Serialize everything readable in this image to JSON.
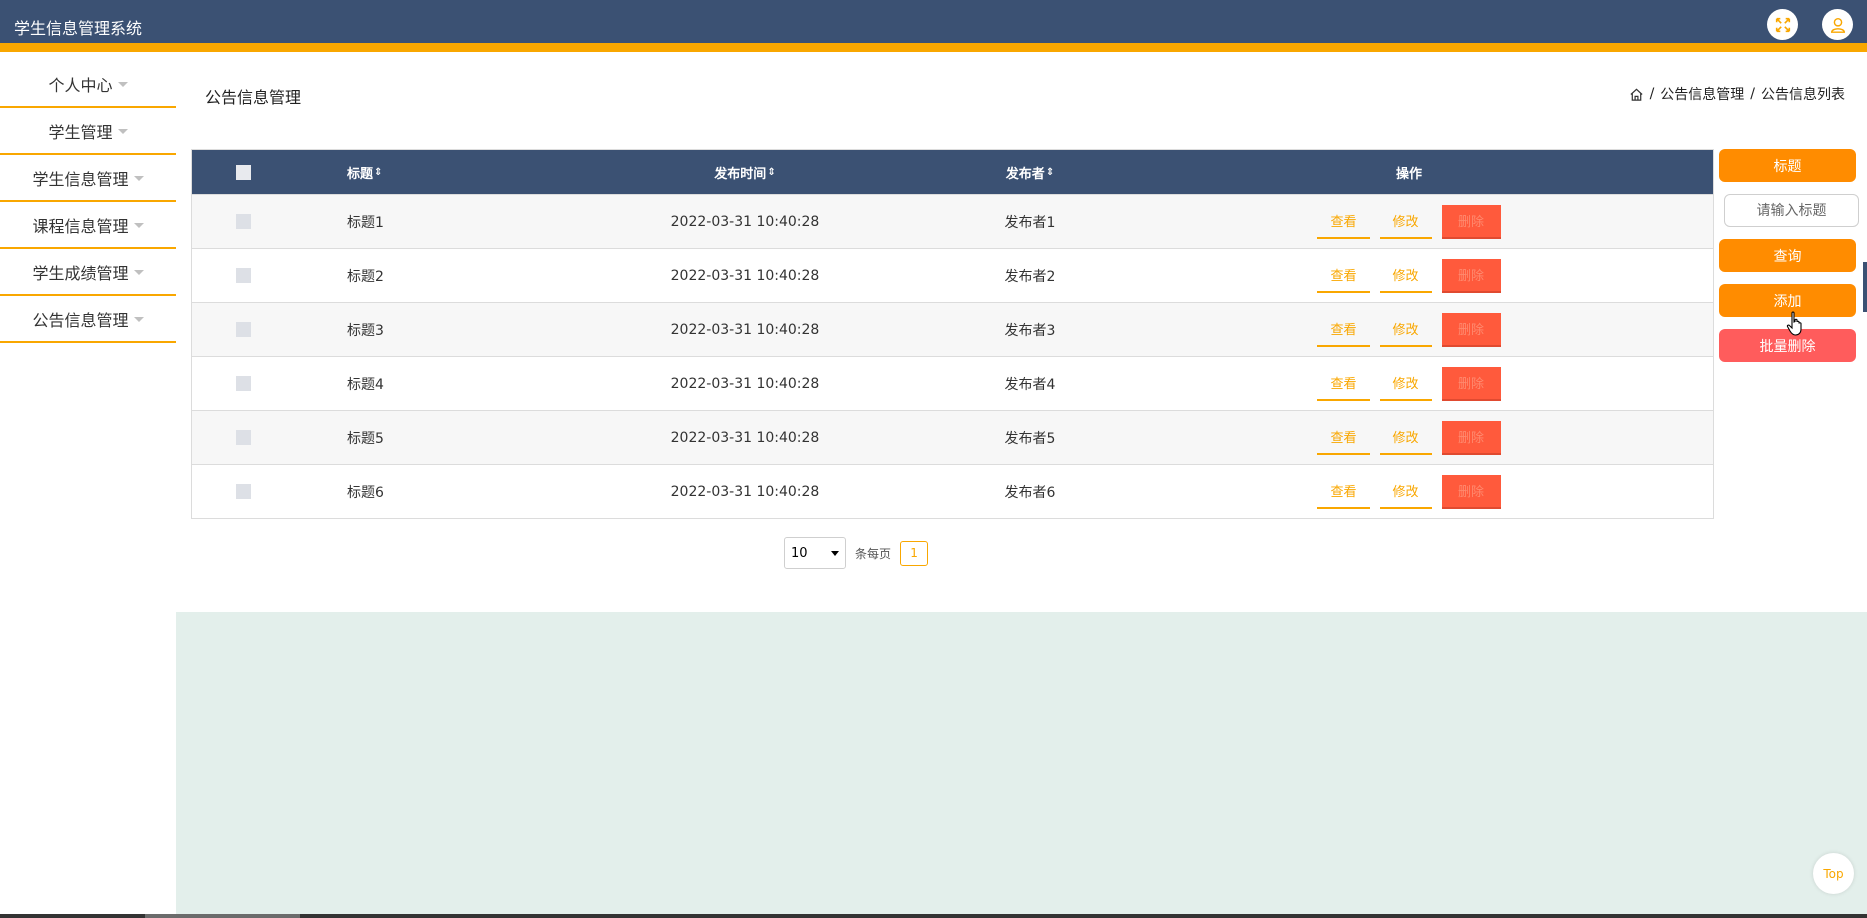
{
  "app": {
    "title": "学生信息管理系统"
  },
  "header": {
    "icons": [
      "fullscreen-icon",
      "user-icon"
    ]
  },
  "sidebar": {
    "items": [
      {
        "label": "个人中心"
      },
      {
        "label": "学生管理"
      },
      {
        "label": "学生信息管理"
      },
      {
        "label": "课程信息管理"
      },
      {
        "label": "学生成绩管理"
      },
      {
        "label": "公告信息管理"
      }
    ]
  },
  "page": {
    "title": "公告信息管理",
    "breadcrumb": {
      "sep": "/",
      "level1": "公告信息管理",
      "level2": "公告信息列表"
    }
  },
  "table": {
    "columns": {
      "title": "标题",
      "time": "发布时间",
      "publisher": "发布者",
      "ops": "操作",
      "sort_icon": "⇕"
    },
    "rows": [
      {
        "title": "标题1",
        "time": "2022-03-31 10:40:28",
        "publisher": "发布者1"
      },
      {
        "title": "标题2",
        "time": "2022-03-31 10:40:28",
        "publisher": "发布者2"
      },
      {
        "title": "标题3",
        "time": "2022-03-31 10:40:28",
        "publisher": "发布者3"
      },
      {
        "title": "标题4",
        "time": "2022-03-31 10:40:28",
        "publisher": "发布者4"
      },
      {
        "title": "标题5",
        "time": "2022-03-31 10:40:28",
        "publisher": "发布者5"
      },
      {
        "title": "标题6",
        "time": "2022-03-31 10:40:28",
        "publisher": "发布者6"
      }
    ],
    "actions": {
      "view": "查看",
      "edit": "修改",
      "delete": "删除"
    }
  },
  "pagination": {
    "page_size": "10",
    "per_page_label": "条每页",
    "current_page": "1"
  },
  "panel": {
    "title_label": "标题",
    "search_placeholder": "请输入标题",
    "query_label": "查询",
    "add_label": "添加",
    "batch_delete_label": "批量删除"
  },
  "back_to_top": "Top",
  "colors": {
    "primary": "#3b5173",
    "accent": "#f9a700",
    "orange": "#ff8c00",
    "danger": "#ff5c5c"
  }
}
